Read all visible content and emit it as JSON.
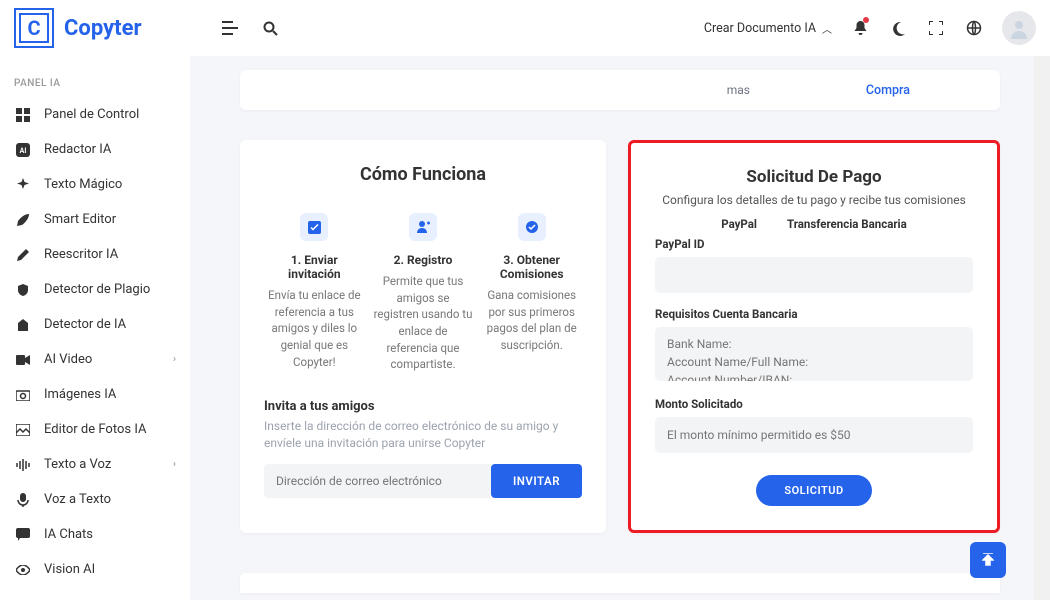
{
  "brand": {
    "letter": "C",
    "name": "Copyter"
  },
  "header": {
    "create_doc": "Crear Documento IA"
  },
  "sidebar": {
    "label": "PANEL IA",
    "items": [
      {
        "label": "Panel de Control"
      },
      {
        "label": "Redactor IA"
      },
      {
        "label": "Texto Mágico"
      },
      {
        "label": "Smart Editor"
      },
      {
        "label": "Reescritor IA"
      },
      {
        "label": "Detector de Plagio"
      },
      {
        "label": "Detector de IA"
      },
      {
        "label": "AI Video",
        "expandable": true
      },
      {
        "label": "Imágenes IA"
      },
      {
        "label": "Editor de Fotos IA"
      },
      {
        "label": "Texto a Voz",
        "expandable": true
      },
      {
        "label": "Voz a Texto"
      },
      {
        "label": "IA Chats"
      },
      {
        "label": "Vision AI"
      }
    ]
  },
  "top_strip": {
    "more": "mas",
    "compra": "Compra"
  },
  "how_it_works": {
    "title": "Cómo Funciona",
    "steps": [
      {
        "title": "1. Enviar invitación",
        "desc": "Envía tu enlace de referencia a tus amigos y diles lo genial que es Copyter!"
      },
      {
        "title": "2. Registro",
        "desc": "Permite que tus amigos se registren usando tu enlace de referencia que compartiste."
      },
      {
        "title": "3. Obtener Comisiones",
        "desc": "Gana comisiones por sus primeros pagos del plan de suscripción."
      }
    ],
    "invite": {
      "heading": "Invita a tus amigos",
      "sub": "Inserte la dirección de correo electrónico de su amigo y envíele una invitación para unirse Copyter",
      "placeholder": "Dirección de correo electrónico",
      "button": "INVITAR"
    }
  },
  "payment": {
    "title": "Solicitud De Pago",
    "sub": "Configura los detalles de tu pago y recibe tus comisiones",
    "tabs": {
      "paypal": "PayPal",
      "bank": "Transferencia Bancaria"
    },
    "paypal_label": "PayPal ID",
    "bank_label": "Requisitos Cuenta Bancaria",
    "bank_placeholder": "Bank Name:\nAccount Name/Full Name:\nAccount Number/IBAN:",
    "amount_label": "Monto Solicitado",
    "amount_placeholder": "El monto mínimo permitido es $50",
    "button": "SOLICITUD"
  }
}
